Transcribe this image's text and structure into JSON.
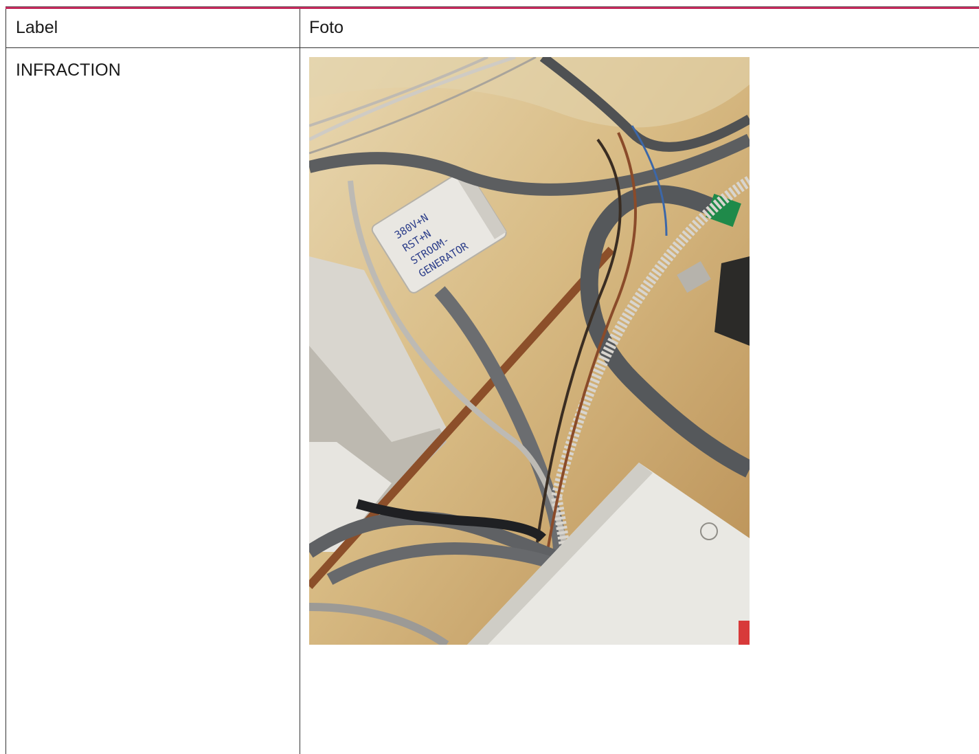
{
  "table": {
    "headers": [
      "Label",
      "Foto"
    ],
    "rows": [
      {
        "label": "INFRACTION",
        "photo": {
          "subject": "electrical-wiring-photo",
          "box_handwriting": [
            "380V+N",
            "RST+N",
            "STROOM-",
            "GENERATOR"
          ]
        }
      }
    ]
  },
  "colors": {
    "accent_rule": "#c2285a",
    "grid": "#333333"
  }
}
